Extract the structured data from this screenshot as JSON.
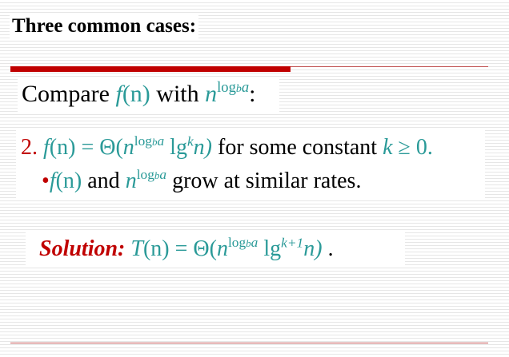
{
  "title": "Three common cases:",
  "compare": {
    "word": "Compare ",
    "f": "f",
    "n_arg": "(n)",
    "with": " with ",
    "n": "n",
    "sup": "log",
    "sub_b": "b",
    "sup_a": "a",
    "colon": ":"
  },
  "case": {
    "number": "2.",
    "f": "f",
    "n_arg": "(n)",
    "eq": " = Θ(",
    "n": "n",
    "sup": "log",
    "sub_b": "b",
    "sup_a": "a",
    "lg": " lg",
    "k_sup": "k",
    "n_close": "n)",
    "constant_text": " for some constant ",
    "k": "k",
    "ge_zero": " ≥ 0.",
    "bullet": "•",
    "b_f": "f",
    "b_n_arg": "(n)",
    "b_and": " and ",
    "b_n": "n",
    "b_sup": "log",
    "b_sub_b": "b",
    "b_sup_a": "a",
    "b_rest": " grow at similar rates."
  },
  "solution": {
    "label": "Solution:",
    "T": " T",
    "n_arg": "(n)",
    "eq": " = Θ(",
    "n": "n",
    "sup": "log",
    "sub_b": "b",
    "sup_a": "a",
    "lg": " lg",
    "k_sup": "k+1",
    "n_close": "n)",
    "period": " ."
  },
  "colors": {
    "title_text": "#000000",
    "accent_red": "#c00000",
    "teal": "#2a9a98"
  }
}
